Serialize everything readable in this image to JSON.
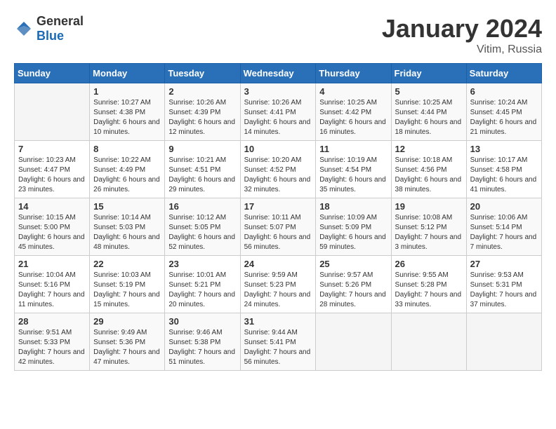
{
  "logo": {
    "general": "General",
    "blue": "Blue"
  },
  "title": "January 2024",
  "location": "Vitim, Russia",
  "days_of_week": [
    "Sunday",
    "Monday",
    "Tuesday",
    "Wednesday",
    "Thursday",
    "Friday",
    "Saturday"
  ],
  "weeks": [
    [
      {
        "day": "",
        "sunrise": "",
        "sunset": "",
        "daylight": ""
      },
      {
        "day": "1",
        "sunrise": "Sunrise: 10:27 AM",
        "sunset": "Sunset: 4:38 PM",
        "daylight": "Daylight: 6 hours and 10 minutes."
      },
      {
        "day": "2",
        "sunrise": "Sunrise: 10:26 AM",
        "sunset": "Sunset: 4:39 PM",
        "daylight": "Daylight: 6 hours and 12 minutes."
      },
      {
        "day": "3",
        "sunrise": "Sunrise: 10:26 AM",
        "sunset": "Sunset: 4:41 PM",
        "daylight": "Daylight: 6 hours and 14 minutes."
      },
      {
        "day": "4",
        "sunrise": "Sunrise: 10:25 AM",
        "sunset": "Sunset: 4:42 PM",
        "daylight": "Daylight: 6 hours and 16 minutes."
      },
      {
        "day": "5",
        "sunrise": "Sunrise: 10:25 AM",
        "sunset": "Sunset: 4:44 PM",
        "daylight": "Daylight: 6 hours and 18 minutes."
      },
      {
        "day": "6",
        "sunrise": "Sunrise: 10:24 AM",
        "sunset": "Sunset: 4:45 PM",
        "daylight": "Daylight: 6 hours and 21 minutes."
      }
    ],
    [
      {
        "day": "7",
        "sunrise": "Sunrise: 10:23 AM",
        "sunset": "Sunset: 4:47 PM",
        "daylight": "Daylight: 6 hours and 23 minutes."
      },
      {
        "day": "8",
        "sunrise": "Sunrise: 10:22 AM",
        "sunset": "Sunset: 4:49 PM",
        "daylight": "Daylight: 6 hours and 26 minutes."
      },
      {
        "day": "9",
        "sunrise": "Sunrise: 10:21 AM",
        "sunset": "Sunset: 4:51 PM",
        "daylight": "Daylight: 6 hours and 29 minutes."
      },
      {
        "day": "10",
        "sunrise": "Sunrise: 10:20 AM",
        "sunset": "Sunset: 4:52 PM",
        "daylight": "Daylight: 6 hours and 32 minutes."
      },
      {
        "day": "11",
        "sunrise": "Sunrise: 10:19 AM",
        "sunset": "Sunset: 4:54 PM",
        "daylight": "Daylight: 6 hours and 35 minutes."
      },
      {
        "day": "12",
        "sunrise": "Sunrise: 10:18 AM",
        "sunset": "Sunset: 4:56 PM",
        "daylight": "Daylight: 6 hours and 38 minutes."
      },
      {
        "day": "13",
        "sunrise": "Sunrise: 10:17 AM",
        "sunset": "Sunset: 4:58 PM",
        "daylight": "Daylight: 6 hours and 41 minutes."
      }
    ],
    [
      {
        "day": "14",
        "sunrise": "Sunrise: 10:15 AM",
        "sunset": "Sunset: 5:00 PM",
        "daylight": "Daylight: 6 hours and 45 minutes."
      },
      {
        "day": "15",
        "sunrise": "Sunrise: 10:14 AM",
        "sunset": "Sunset: 5:03 PM",
        "daylight": "Daylight: 6 hours and 48 minutes."
      },
      {
        "day": "16",
        "sunrise": "Sunrise: 10:12 AM",
        "sunset": "Sunset: 5:05 PM",
        "daylight": "Daylight: 6 hours and 52 minutes."
      },
      {
        "day": "17",
        "sunrise": "Sunrise: 10:11 AM",
        "sunset": "Sunset: 5:07 PM",
        "daylight": "Daylight: 6 hours and 56 minutes."
      },
      {
        "day": "18",
        "sunrise": "Sunrise: 10:09 AM",
        "sunset": "Sunset: 5:09 PM",
        "daylight": "Daylight: 6 hours and 59 minutes."
      },
      {
        "day": "19",
        "sunrise": "Sunrise: 10:08 AM",
        "sunset": "Sunset: 5:12 PM",
        "daylight": "Daylight: 7 hours and 3 minutes."
      },
      {
        "day": "20",
        "sunrise": "Sunrise: 10:06 AM",
        "sunset": "Sunset: 5:14 PM",
        "daylight": "Daylight: 7 hours and 7 minutes."
      }
    ],
    [
      {
        "day": "21",
        "sunrise": "Sunrise: 10:04 AM",
        "sunset": "Sunset: 5:16 PM",
        "daylight": "Daylight: 7 hours and 11 minutes."
      },
      {
        "day": "22",
        "sunrise": "Sunrise: 10:03 AM",
        "sunset": "Sunset: 5:19 PM",
        "daylight": "Daylight: 7 hours and 15 minutes."
      },
      {
        "day": "23",
        "sunrise": "Sunrise: 10:01 AM",
        "sunset": "Sunset: 5:21 PM",
        "daylight": "Daylight: 7 hours and 20 minutes."
      },
      {
        "day": "24",
        "sunrise": "Sunrise: 9:59 AM",
        "sunset": "Sunset: 5:23 PM",
        "daylight": "Daylight: 7 hours and 24 minutes."
      },
      {
        "day": "25",
        "sunrise": "Sunrise: 9:57 AM",
        "sunset": "Sunset: 5:26 PM",
        "daylight": "Daylight: 7 hours and 28 minutes."
      },
      {
        "day": "26",
        "sunrise": "Sunrise: 9:55 AM",
        "sunset": "Sunset: 5:28 PM",
        "daylight": "Daylight: 7 hours and 33 minutes."
      },
      {
        "day": "27",
        "sunrise": "Sunrise: 9:53 AM",
        "sunset": "Sunset: 5:31 PM",
        "daylight": "Daylight: 7 hours and 37 minutes."
      }
    ],
    [
      {
        "day": "28",
        "sunrise": "Sunrise: 9:51 AM",
        "sunset": "Sunset: 5:33 PM",
        "daylight": "Daylight: 7 hours and 42 minutes."
      },
      {
        "day": "29",
        "sunrise": "Sunrise: 9:49 AM",
        "sunset": "Sunset: 5:36 PM",
        "daylight": "Daylight: 7 hours and 47 minutes."
      },
      {
        "day": "30",
        "sunrise": "Sunrise: 9:46 AM",
        "sunset": "Sunset: 5:38 PM",
        "daylight": "Daylight: 7 hours and 51 minutes."
      },
      {
        "day": "31",
        "sunrise": "Sunrise: 9:44 AM",
        "sunset": "Sunset: 5:41 PM",
        "daylight": "Daylight: 7 hours and 56 minutes."
      },
      {
        "day": "",
        "sunrise": "",
        "sunset": "",
        "daylight": ""
      },
      {
        "day": "",
        "sunrise": "",
        "sunset": "",
        "daylight": ""
      },
      {
        "day": "",
        "sunrise": "",
        "sunset": "",
        "daylight": ""
      }
    ]
  ]
}
